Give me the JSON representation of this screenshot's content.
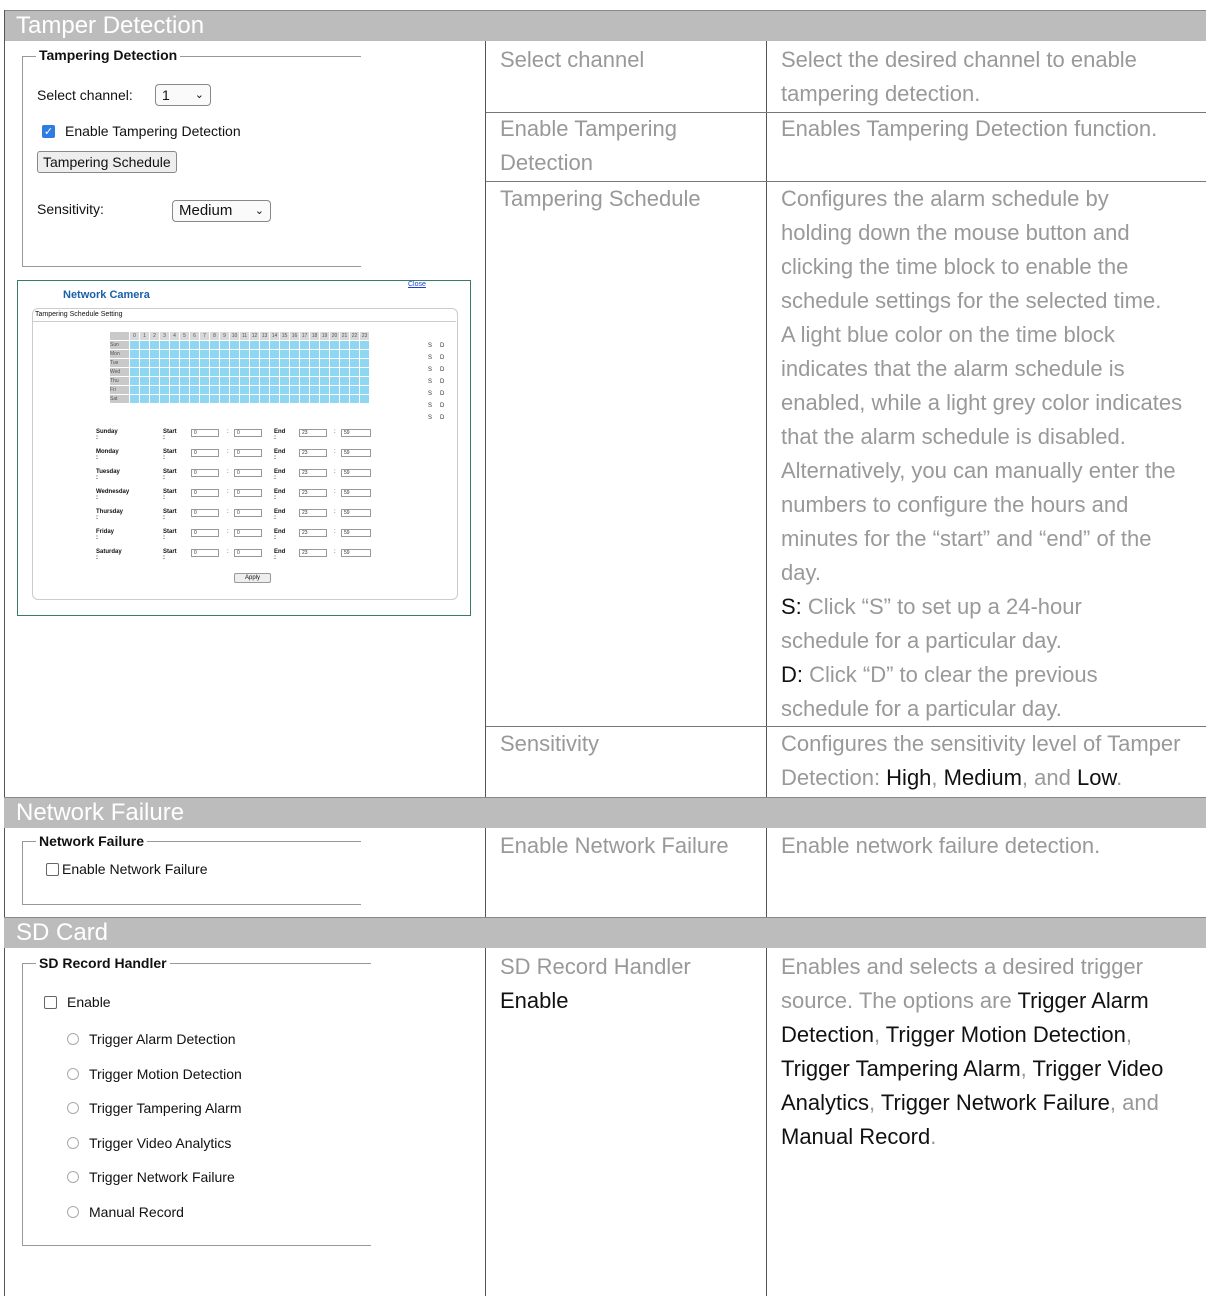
{
  "sections": {
    "tamper": "Tamper Detection",
    "network": "Network Failure",
    "sd": "SD Card"
  },
  "tamper_panel": {
    "legend": "Tampering Detection",
    "select_label": "Select channel:",
    "channel_value": "1",
    "enable_label": "Enable Tampering Detection",
    "schedule_button": "Tampering Schedule",
    "sensitivity_label": "Sensitivity:",
    "sensitivity_value": "Medium"
  },
  "schedule_window": {
    "title": "Network Camera",
    "close": "Close",
    "subtitle": "Tampering Schedule Setting",
    "hours": [
      "0",
      "1",
      "2",
      "3",
      "4",
      "5",
      "6",
      "7",
      "8",
      "9",
      "10",
      "11",
      "12",
      "13",
      "14",
      "15",
      "16",
      "17",
      "18",
      "19",
      "20",
      "21",
      "22",
      "23"
    ],
    "days_short": [
      "Sun",
      "Mon",
      "Tue",
      "Wed",
      "Thu",
      "Fri",
      "Sat"
    ],
    "days": [
      "Sunday :",
      "Monday :",
      "Tuesday :",
      "Wednesday :",
      "Thursday :",
      "Friday :",
      "Saturday :"
    ],
    "start_label": "Start :",
    "end_label": "End :",
    "start_h": "0",
    "start_m": "0",
    "end_h": "23",
    "end_m": "59",
    "s": "S",
    "d": "D",
    "apply": "Apply"
  },
  "tamper_rows": [
    {
      "name": "Select channel",
      "desc": "Select the desired channel to enable tampering detection."
    },
    {
      "name": "Enable Tampering Detection",
      "desc": "Enables Tampering Detection function."
    },
    {
      "name": "Tampering Schedule",
      "desc_lines": [
        "Configures the alarm schedule by",
        "holding down the mouse button and",
        "clicking the time block to enable the",
        "schedule settings for the selected time.",
        "A light blue color on the time block",
        "indicates that the alarm schedule is",
        "enabled, while a light grey color indicates",
        "that the alarm schedule is disabled.",
        "Alternatively, you can manually enter the",
        "numbers to configure the hours and",
        "minutes for the “start” and “end” of the",
        "day."
      ],
      "s_key": "S:",
      "s_text_1": " Click “S” to set up a 24-hour",
      "s_text_2": "schedule for a particular day.",
      "d_key": "D:",
      "d_text_1": " Click “D” to clear the previous",
      "d_text_2": "schedule for a particular day."
    },
    {
      "name": "Sensitivity",
      "desc_1": "Configures the sensitivity level of Tamper",
      "desc_2a": "Detection: ",
      "high": "High",
      "comma1": ", ",
      "medium": "Medium",
      "and": ", and ",
      "low": "Low",
      "dot": "."
    }
  ],
  "network_panel": {
    "legend": "Network Failure",
    "enable_label": "Enable Network Failure"
  },
  "network_row": {
    "name": "Enable Network Failure",
    "desc": "Enable network failure detection."
  },
  "sd_panel": {
    "legend": "SD Record Handler",
    "enable_label": "Enable",
    "options": [
      "Trigger Alarm Detection",
      "Trigger Motion Detection",
      "Trigger Tampering Alarm",
      "Trigger Video Analytics",
      "Trigger Network Failure",
      "Manual Record"
    ]
  },
  "sd_row": {
    "name_1": "SD Record Handler",
    "name_2": "Enable",
    "d1": "Enables and selects a desired trigger",
    "d2a": "source. The options are ",
    "o1": "Trigger Alarm",
    "o1b": "Detection",
    "c1": ", ",
    "o2": "Trigger Motion Detection",
    "c2": ",",
    "o3": "Trigger Tampering Alarm",
    "c3": ", ",
    "o4": "Trigger Video",
    "o4b": "Analytics",
    "c4": ", ",
    "o5": "Trigger Network Failure",
    "c5": ", and",
    "o6": "Manual Record",
    "c6": "."
  }
}
